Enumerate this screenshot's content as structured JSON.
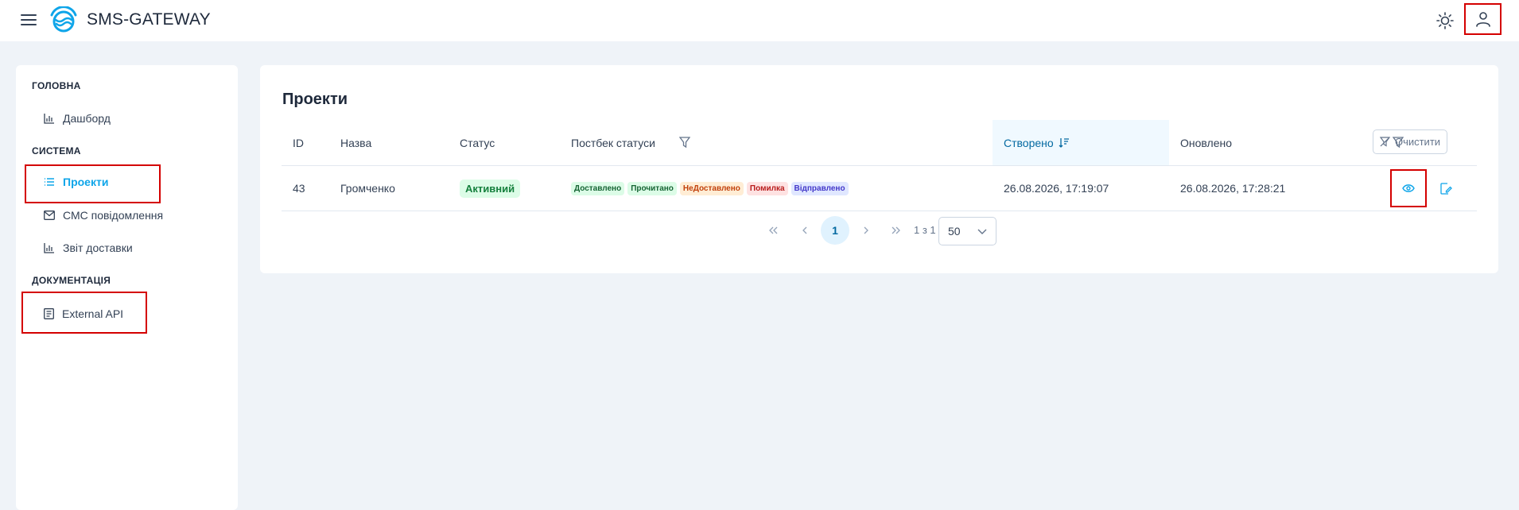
{
  "app": {
    "brand": "SMS-GATEWAY"
  },
  "topbar": {
    "theme_icon": "sun-icon",
    "user_icon": "user-icon",
    "menu_icon": "hamburger-icon"
  },
  "sidebar": {
    "sections": [
      {
        "title": "ГОЛОВНА",
        "items": [
          {
            "label": "Дашборд",
            "icon": "chart-bar-icon"
          }
        ]
      },
      {
        "title": "СИСТЕМА",
        "items": [
          {
            "label": "Проекти",
            "icon": "list-icon",
            "active": true
          },
          {
            "label": "СМС повідомлення",
            "icon": "envelope-icon"
          },
          {
            "label": "Звіт доставки",
            "icon": "chart-bar-icon"
          }
        ]
      },
      {
        "title": "ДОКУМЕНТАЦІЯ",
        "items": [
          {
            "label": "External API",
            "icon": "book-icon"
          }
        ]
      }
    ]
  },
  "projects": {
    "title": "Проекти",
    "columns": {
      "id": "ID",
      "name": "Назва",
      "status": "Статус",
      "postback": "Постбек статуси",
      "created": "Створено",
      "updated": "Оновлено"
    },
    "clear_label": "Очистити",
    "rows": [
      {
        "id": "43",
        "name": "Громченко",
        "status": "Активний",
        "postback": [
          "Доставлено",
          "Прочитано",
          "НеДоставлено",
          "Помилка",
          "Відправлено"
        ],
        "created": "26.08.2026, 17:19:07",
        "updated": "26.08.2026, 17:28:21"
      }
    ],
    "pagination": {
      "current_page": "1",
      "page_info": "1 з 1",
      "rows_per_page": "50"
    }
  },
  "colors": {
    "accent": "#0ea5e9",
    "highlight": "#d40000"
  }
}
